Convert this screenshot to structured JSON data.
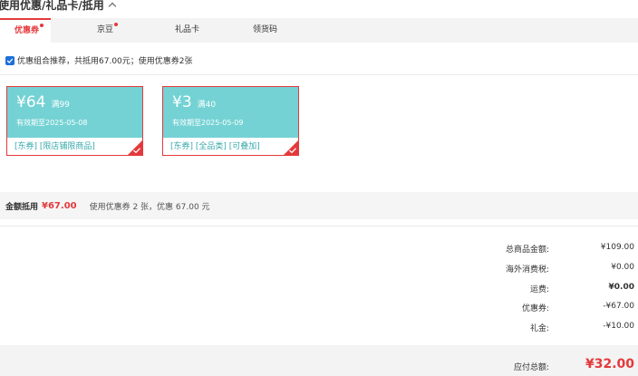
{
  "section": {
    "title": "使用优惠/礼品卡/抵用"
  },
  "tabs": [
    {
      "label": "优惠券",
      "active": true,
      "dot": true
    },
    {
      "label": "京豆",
      "active": false,
      "dot": true
    },
    {
      "label": "礼品卡",
      "active": false,
      "dot": false
    },
    {
      "label": "领货码",
      "active": false,
      "dot": false
    }
  ],
  "combo": {
    "checked": true,
    "text": "优惠组合推荐，共抵用67.00元；使用优惠券2张"
  },
  "coupons": [
    {
      "amount": "¥64",
      "condition": "满99",
      "valid": "有效期至2025-05-08",
      "tags": "[东券] [限店铺限商品]",
      "selected": true
    },
    {
      "amount": "¥3",
      "condition": "满40",
      "valid": "有效期至2025-05-09",
      "tags": "[东券] [全品类] [可叠加]",
      "selected": true
    }
  ],
  "summary": {
    "label": "金额抵用",
    "value": "¥67.00",
    "desc": "使用优惠券 2 张，优惠 67.00 元"
  },
  "totals": [
    {
      "label": "总商品金额:",
      "value": "¥109.00",
      "bold": false
    },
    {
      "label": "海外消费税:",
      "value": "¥0.00",
      "bold": false
    },
    {
      "label": "运费:",
      "value": "¥0.00",
      "bold": true
    },
    {
      "label": "优惠券:",
      "value": "-¥67.00",
      "bold": false
    },
    {
      "label": "礼金:",
      "value": "-¥10.00",
      "bold": false
    }
  ],
  "payable": {
    "label": "应付总额:",
    "value": "¥32.00"
  },
  "colors": {
    "accent": "#e4393c",
    "coupon_bg": "#74d2d4",
    "checkbox": "#1f6fd8"
  }
}
